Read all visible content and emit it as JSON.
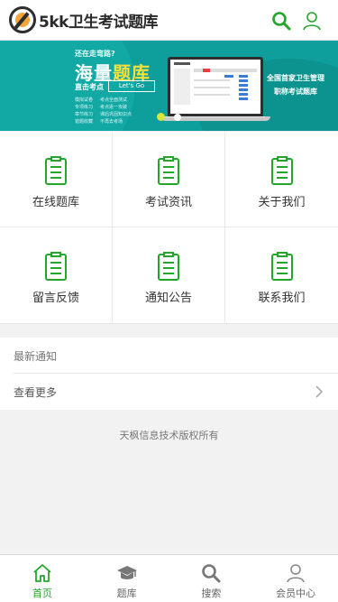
{
  "header": {
    "logo_text": "5kk卫生考试题库",
    "search_icon": "search-icon",
    "user_icon": "user-icon"
  },
  "banner": {
    "top_text": "还在走弯路?",
    "headline_a": "海量",
    "headline_b": "题库",
    "line_left": "直击考点",
    "btn_text": "Let's Go",
    "list": [
      [
        "模拟试卷",
        "考点全面测试"
      ],
      [
        "专项练习",
        "考点逐一攻破"
      ],
      [
        "章节练习",
        "课后巩固知识点"
      ],
      [
        "错题收藏",
        "不再去考场"
      ]
    ],
    "right_line1": "全国首家卫生管理",
    "right_line2": "职称考试题库"
  },
  "grid": [
    {
      "label": "在线题库",
      "icon": "clipboard-icon"
    },
    {
      "label": "考试资讯",
      "icon": "clipboard-icon"
    },
    {
      "label": "关于我们",
      "icon": "clipboard-icon"
    },
    {
      "label": "留言反馈",
      "icon": "clipboard-icon"
    },
    {
      "label": "通知公告",
      "icon": "clipboard-icon"
    },
    {
      "label": "联系我们",
      "icon": "clipboard-icon"
    }
  ],
  "notice": {
    "title": "最新通知",
    "more": "查看更多"
  },
  "footer": {
    "copyright": "天枫信息技术版权所有"
  },
  "bottom_nav": [
    {
      "label": "首页",
      "icon": "home-icon",
      "active": true
    },
    {
      "label": "题库",
      "icon": "graduation-cap-icon",
      "active": false
    },
    {
      "label": "搜索",
      "icon": "search-icon",
      "active": false
    },
    {
      "label": "会员中心",
      "icon": "user-icon",
      "active": false
    }
  ],
  "colors": {
    "accent": "#24a52b",
    "banner": "#0e9e9b"
  }
}
